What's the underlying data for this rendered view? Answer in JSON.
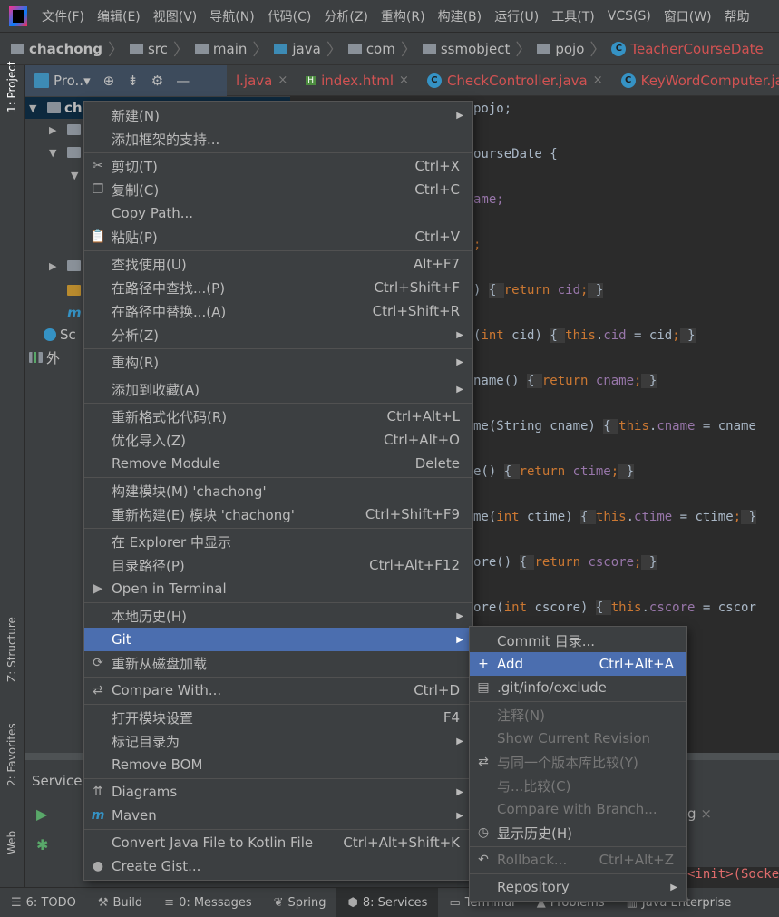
{
  "menubar": {
    "items": [
      "文件(F)",
      "编辑(E)",
      "视图(V)",
      "导航(N)",
      "代码(C)",
      "分析(Z)",
      "重构(R)",
      "构建(B)",
      "运行(U)",
      "工具(T)",
      "VCS(S)",
      "窗口(W)",
      "帮助"
    ]
  },
  "breadcrumb": [
    "chachong",
    "src",
    "main",
    "java",
    "com",
    "ssmobject",
    "pojo",
    "TeacherCourseDate"
  ],
  "project_header": {
    "label": "Pro..▾"
  },
  "tabs": [
    {
      "label": "l.java",
      "icon": "java-class"
    },
    {
      "label": "index.html",
      "icon": "html-file"
    },
    {
      "label": "CheckController.java",
      "icon": "java-class"
    },
    {
      "label": "KeyWordComputer.ja",
      "icon": "java-class"
    }
  ],
  "left_stripe": {
    "project": "1: Project",
    "structure": "Z: Structure",
    "favorites": "2: Favorites",
    "web": "Web"
  },
  "tree": [
    {
      "label": "ch",
      "expanded": true
    },
    {
      "label": "",
      "expanded": false
    },
    {
      "label": "",
      "expanded": true
    },
    {
      "label": "",
      "expanded": true
    },
    {
      "label": "",
      "expanded": false
    },
    {
      "label": "",
      "icon": "sql-file"
    },
    {
      "label": "",
      "icon": "maven-file"
    },
    {
      "label": "Sc",
      "icon": "scratches"
    },
    {
      "label": "外",
      "icon": "external-libraries"
    }
  ],
  "code": [
    [
      [
        "pojo;",
        "p"
      ]
    ],
    [
      [
        "ourseDate {",
        "p"
      ]
    ],
    [
      [
        "ame;",
        "f"
      ]
    ],
    [
      [
        ";",
        "k"
      ]
    ],
    [
      [
        ") ",
        "p"
      ],
      [
        "{ ",
        "b"
      ],
      [
        "return ",
        "k"
      ],
      [
        "cid",
        "f"
      ],
      [
        ";",
        "k"
      ],
      [
        " }",
        "b"
      ]
    ],
    [
      [
        "(",
        "p"
      ],
      [
        "int ",
        "k"
      ],
      [
        "cid) ",
        "p"
      ],
      [
        "{ ",
        "b"
      ],
      [
        "this",
        "k"
      ],
      [
        ".",
        "p"
      ],
      [
        "cid",
        "f"
      ],
      [
        " = cid",
        "p"
      ],
      [
        ";",
        "k"
      ],
      [
        " }",
        "b"
      ]
    ],
    [
      [
        "name() ",
        "p"
      ],
      [
        "{ ",
        "b"
      ],
      [
        "return ",
        "k"
      ],
      [
        "cname",
        "f"
      ],
      [
        ";",
        "k"
      ],
      [
        " }",
        "b"
      ]
    ],
    [
      [
        "me(String cname) ",
        "p"
      ],
      [
        "{ ",
        "b"
      ],
      [
        "this",
        "k"
      ],
      [
        ".",
        "p"
      ],
      [
        "cname",
        "f"
      ],
      [
        " = cname",
        "p"
      ]
    ],
    [
      [
        "e() ",
        "p"
      ],
      [
        "{ ",
        "b"
      ],
      [
        "return ",
        "k"
      ],
      [
        "ctime",
        "f"
      ],
      [
        ";",
        "k"
      ],
      [
        " }",
        "b"
      ]
    ],
    [
      [
        "me(",
        "p"
      ],
      [
        "int ",
        "k"
      ],
      [
        "ctime) ",
        "p"
      ],
      [
        "{ ",
        "b"
      ],
      [
        "this",
        "k"
      ],
      [
        ".",
        "p"
      ],
      [
        "ctime",
        "f"
      ],
      [
        " = ctime",
        "p"
      ],
      [
        ";",
        "k"
      ],
      [
        " }",
        "b"
      ]
    ],
    [
      [
        "ore() ",
        "p"
      ],
      [
        "{ ",
        "b"
      ],
      [
        "return ",
        "k"
      ],
      [
        "cscore",
        "f"
      ],
      [
        ";",
        "k"
      ],
      [
        " }",
        "b"
      ]
    ],
    [
      [
        "ore(",
        "p"
      ],
      [
        "int ",
        "k"
      ],
      [
        "cscore) ",
        "p"
      ],
      [
        "{ ",
        "b"
      ],
      [
        "this",
        "k"
      ],
      [
        ".",
        "p"
      ],
      [
        "cscore",
        "f"
      ],
      [
        " = cscor",
        "p"
      ]
    ]
  ],
  "services": {
    "title": "Services",
    "tab_fragment": "g",
    "log_fragment": "<init>(Socke"
  },
  "bottom_tabs": [
    {
      "label": "6: TODO",
      "icon": "list-icon"
    },
    {
      "label": "Build",
      "icon": "hammer-icon"
    },
    {
      "label": "0: Messages",
      "icon": "messages-icon"
    },
    {
      "label": "Spring",
      "icon": "spring-icon"
    },
    {
      "label": "8: Services",
      "icon": "services-icon",
      "selected": true
    },
    {
      "label": "Terminal",
      "icon": "terminal-icon"
    },
    {
      "label": "Problems",
      "icon": "warning-icon"
    },
    {
      "label": "Java Enterprise",
      "icon": "enterprise-icon"
    }
  ],
  "context_menu": [
    {
      "label": "新建(N)",
      "submenu": true
    },
    {
      "label": "添加框架的支持..."
    },
    {
      "sep": true
    },
    {
      "label": "剪切(T)",
      "shortcut": "Ctrl+X",
      "icon": "✂",
      "icon_name": "cut-icon"
    },
    {
      "label": "复制(C)",
      "shortcut": "Ctrl+C",
      "icon": "❐",
      "icon_name": "copy-icon"
    },
    {
      "label": "Copy Path..."
    },
    {
      "label": "粘贴(P)",
      "shortcut": "Ctrl+V",
      "icon": "📋",
      "icon_name": "paste-icon"
    },
    {
      "sep": true
    },
    {
      "label": "查找使用(U)",
      "shortcut": "Alt+F7"
    },
    {
      "label": "在路径中查找...(P)",
      "shortcut": "Ctrl+Shift+F"
    },
    {
      "label": "在路径中替换...(A)",
      "shortcut": "Ctrl+Shift+R"
    },
    {
      "label": "分析(Z)",
      "submenu": true
    },
    {
      "sep": true
    },
    {
      "label": "重构(R)",
      "submenu": true
    },
    {
      "sep": true
    },
    {
      "label": "添加到收藏(A)",
      "submenu": true
    },
    {
      "sep": true
    },
    {
      "label": "重新格式化代码(R)",
      "shortcut": "Ctrl+Alt+L"
    },
    {
      "label": "优化导入(Z)",
      "shortcut": "Ctrl+Alt+O"
    },
    {
      "label": "Remove Module",
      "shortcut": "Delete"
    },
    {
      "sep": true
    },
    {
      "label": "构建模块(M) 'chachong'"
    },
    {
      "label": "重新构建(E) 模块 'chachong'",
      "shortcut": "Ctrl+Shift+F9"
    },
    {
      "sep": true
    },
    {
      "label": "在 Explorer 中显示"
    },
    {
      "label": "目录路径(P)",
      "shortcut": "Ctrl+Alt+F12"
    },
    {
      "label": "Open in Terminal",
      "icon": "▶",
      "icon_name": "terminal-icon"
    },
    {
      "sep": true
    },
    {
      "label": "本地历史(H)",
      "submenu": true
    },
    {
      "label": "Git",
      "submenu": true,
      "selected": true
    },
    {
      "label": "重新从磁盘加载",
      "icon": "⟳",
      "icon_name": "reload-icon"
    },
    {
      "sep": true
    },
    {
      "label": "Compare With...",
      "shortcut": "Ctrl+D",
      "icon": "⇄",
      "icon_name": "compare-icon"
    },
    {
      "sep": true
    },
    {
      "label": "打开模块设置",
      "shortcut": "F4"
    },
    {
      "label": "标记目录为",
      "submenu": true
    },
    {
      "label": "Remove BOM"
    },
    {
      "sep": true
    },
    {
      "label": "Diagrams",
      "submenu": true,
      "icon": "⇈",
      "icon_name": "diagrams-icon"
    },
    {
      "label": "Maven",
      "submenu": true,
      "icon": "m",
      "icon_name": "maven-icon"
    },
    {
      "sep": true
    },
    {
      "label": "Convert Java File to Kotlin File",
      "shortcut": "Ctrl+Alt+Shift+K"
    },
    {
      "label": "Create Gist...",
      "icon": "●",
      "icon_name": "github-icon"
    }
  ],
  "git_submenu": [
    {
      "label": "Commit 目录..."
    },
    {
      "label": "Add",
      "shortcut": "Ctrl+Alt+A",
      "selected": true,
      "icon": "+",
      "icon_name": "add-icon"
    },
    {
      "label": ".git/info/exclude",
      "icon": "▤",
      "icon_name": "file-icon"
    },
    {
      "sep": true
    },
    {
      "label": "注释(N)",
      "disabled": true
    },
    {
      "label": "Show Current Revision",
      "disabled": true
    },
    {
      "label": "与同一个版本库比较(Y)",
      "disabled": true,
      "icon": "⇄",
      "icon_name": "compare-icon"
    },
    {
      "label": "与...比较(C)",
      "disabled": true
    },
    {
      "label": "Compare with Branch...",
      "disabled": true
    },
    {
      "label": "显示历史(H)",
      "icon": "◷",
      "icon_name": "history-icon"
    },
    {
      "sep": true
    },
    {
      "label": "Rollback...",
      "shortcut": "Ctrl+Alt+Z",
      "disabled": true,
      "icon": "↶",
      "icon_name": "rollback-icon"
    },
    {
      "sep": true
    },
    {
      "label": "Repository",
      "submenu": true
    }
  ],
  "colors": {
    "accent": "#4b6eaf",
    "error_tab": "#d25252",
    "keyword": "#cc7832",
    "field": "#9876aa"
  }
}
